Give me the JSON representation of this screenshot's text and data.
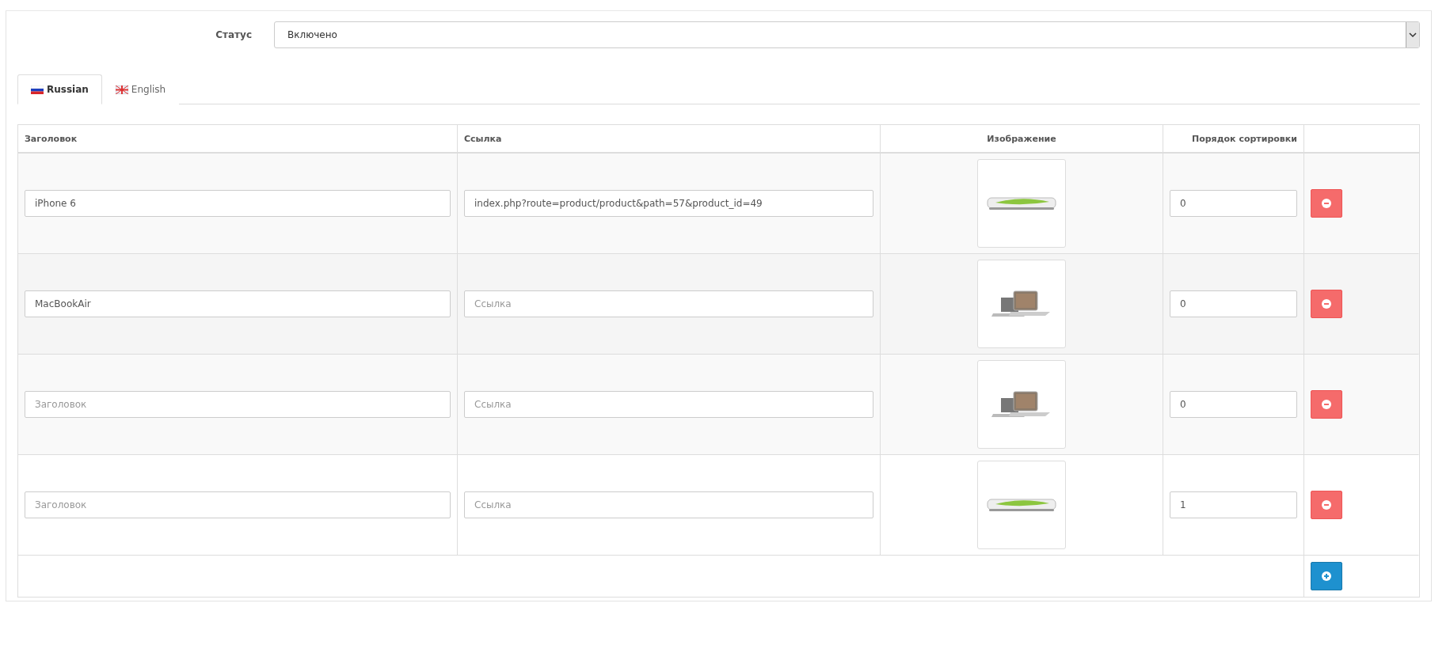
{
  "status": {
    "label": "Статус",
    "value": "Включено"
  },
  "tabs": [
    {
      "label": "Russian",
      "selected": true
    },
    {
      "label": "English",
      "selected": false
    }
  ],
  "table": {
    "columns": [
      "Заголовок",
      "Ссылка",
      "Изображение",
      "Порядок сортировки"
    ],
    "rows": [
      {
        "title": {
          "value": "iPhone 6"
        },
        "link": {
          "value": "index.php?route=product/product&path=57&product_id=49"
        },
        "kind": "phone",
        "sort": "0"
      },
      {
        "title": {
          "value": "MacBookAir"
        },
        "link": {
          "placeholder": "Ссылка"
        },
        "kind": "laptop",
        "sort": "0"
      },
      {
        "title": {
          "placeholder": "Заголовок"
        },
        "link": {
          "placeholder": "Ссылка"
        },
        "kind": "laptop",
        "sort": "0"
      },
      {
        "title": {
          "placeholder": "Заголовок"
        },
        "link": {
          "placeholder": "Ссылка"
        },
        "kind": "phone",
        "sort": "1"
      }
    ]
  }
}
